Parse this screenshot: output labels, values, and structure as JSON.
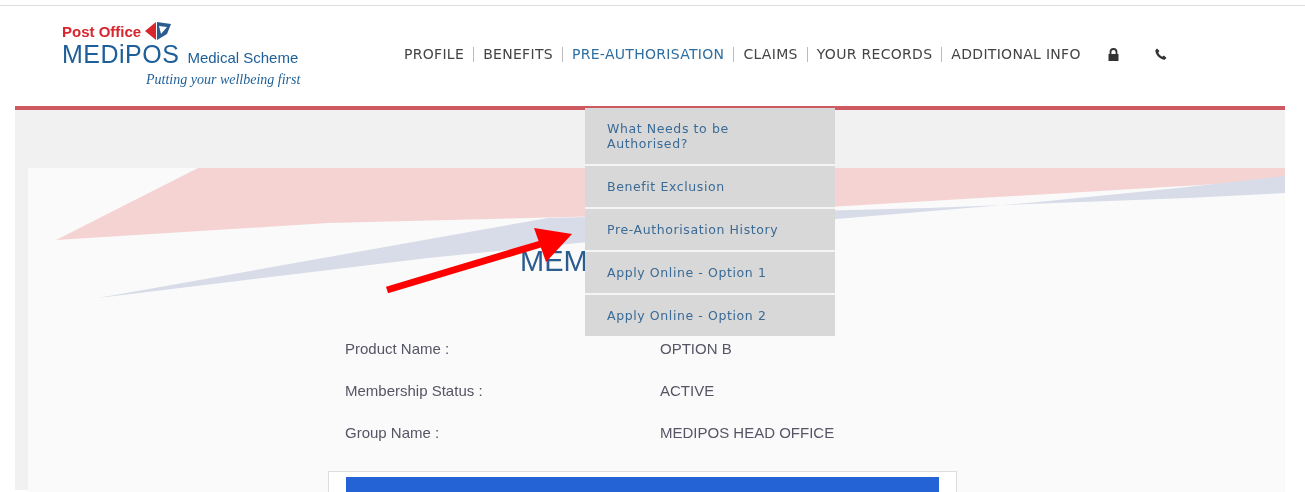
{
  "logo": {
    "brand": "Post Office",
    "name": "MEDiPOS",
    "subtitle": "Medical Scheme",
    "tagline": "Putting your wellbeing first"
  },
  "nav": [
    {
      "label": "PROFILE",
      "selected": false
    },
    {
      "label": "BENEFITS",
      "selected": false
    },
    {
      "label": "PRE-AUTHORISATION",
      "selected": true
    },
    {
      "label": "CLAIMS",
      "selected": false
    },
    {
      "label": "YOUR RECORDS",
      "selected": false
    },
    {
      "label": "ADDITIONAL INFO",
      "selected": false
    }
  ],
  "dropdown": [
    {
      "label": "What Needs to be Authorised?"
    },
    {
      "label": "Benefit Exclusion"
    },
    {
      "label": "Pre-Authorisation History"
    },
    {
      "label": "Apply Online - Option 1"
    },
    {
      "label": "Apply Online - Option 2"
    }
  ],
  "heading": "MEM",
  "details": [
    {
      "label": "Product Name :",
      "value": "OPTION B"
    },
    {
      "label": "Membership Status :",
      "value": "ACTIVE"
    },
    {
      "label": "Group Name :",
      "value": "MEDIPOS HEAD OFFICE"
    }
  ]
}
